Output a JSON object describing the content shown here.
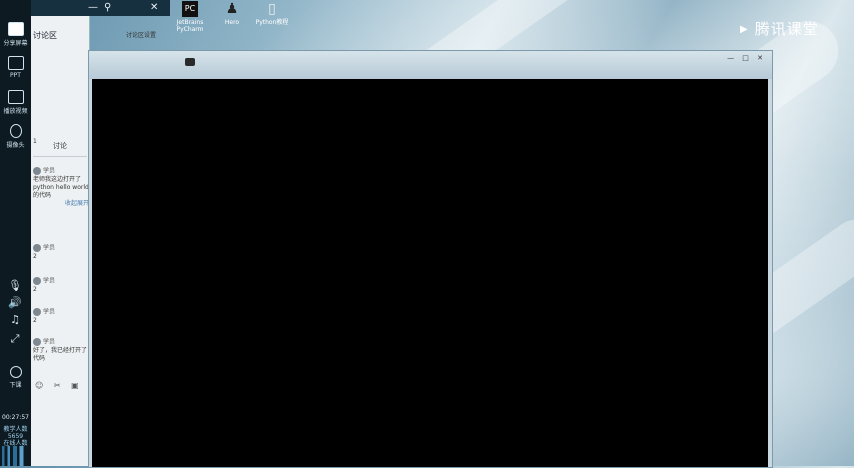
{
  "brand": {
    "play_glyph": "▶",
    "name": "腾讯课堂"
  },
  "topbar": {
    "icons": [
      "add-icon",
      "user-icon",
      "minimize-icon",
      "pin-icon",
      "close-icon"
    ]
  },
  "desktop": {
    "icons": [
      {
        "name": "pycharm",
        "glyph": "PC",
        "label": "JetBrains PyCharm"
      },
      {
        "name": "app",
        "glyph": "♟",
        "label": "Hero"
      },
      {
        "name": "doc",
        "glyph": "▯",
        "label": "Python教程"
      }
    ]
  },
  "leftbar": {
    "items": [
      {
        "label": "分享屏幕",
        "active": true
      },
      {
        "label": "PPT",
        "active": false
      },
      {
        "label": "播放视频",
        "active": false
      },
      {
        "label": "摄像头",
        "active": false
      }
    ],
    "small_icons": [
      "mic-icon",
      "speaker-icon",
      "music-icon",
      "expand-icon"
    ],
    "stop_label": "下课",
    "timer": "00:27:57",
    "stats": [
      "教学人数",
      "5659",
      "在线人数"
    ]
  },
  "chat": {
    "title": "讨论区",
    "header_note": "讨论区设置",
    "tab": "讨论",
    "messages": [
      {
        "name": "学员",
        "body": "1"
      },
      {
        "name": "学员",
        "body": "老师我这边打开了 python hello world 的代码",
        "link": "收起展开"
      },
      {
        "name": "学员",
        "body": "2"
      },
      {
        "name": "学员",
        "body": "2"
      },
      {
        "name": "学员",
        "body": "2"
      },
      {
        "name": "学员",
        "body": "好了，我已经打开了代码"
      }
    ],
    "tools": "☺ ✂ ▣"
  },
  "window": {
    "controls": "— □ ✕"
  }
}
